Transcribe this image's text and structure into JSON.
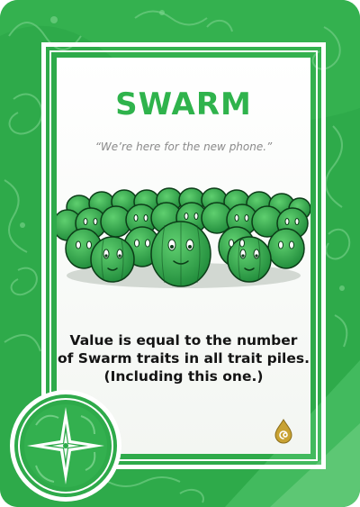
{
  "card": {
    "title": "SWARM",
    "flavor_text": "“We’re here for the new phone.”",
    "rules_text_lines": [
      "Value is equal to the number",
      "of Swarm traits in all trait piles.",
      "(Including this one.)"
    ],
    "art": "swarm-of-green-creatures",
    "badge_icon": "compass-star-icon",
    "set_icon": "drop-swirl-icon"
  },
  "colors": {
    "frame": "#2eaa4a",
    "title": "#2fb34c",
    "creature": "#3bb35a",
    "set_icon": "#c8a233"
  }
}
